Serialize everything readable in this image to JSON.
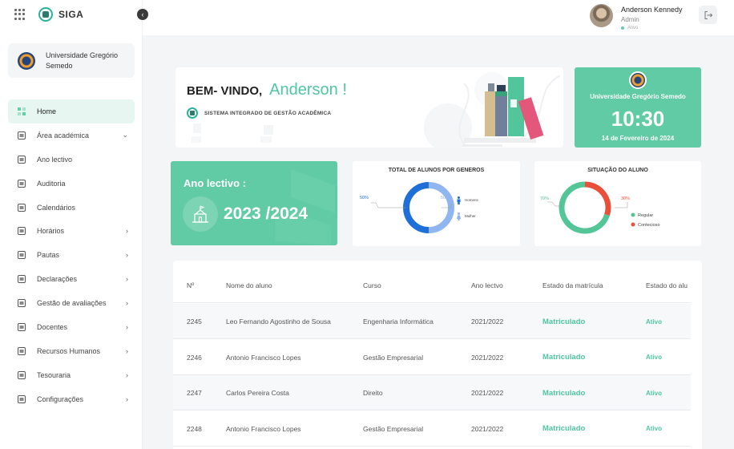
{
  "app": {
    "name": "SIGA"
  },
  "sidebar": {
    "university": "Universidade Gregório Semedo",
    "items": [
      {
        "label": "Home",
        "active": true,
        "chevron": ""
      },
      {
        "label": "Área académica",
        "chevron": "⌄"
      },
      {
        "label": "Ano lectivo",
        "chevron": ""
      },
      {
        "label": "Auditoria",
        "chevron": ""
      },
      {
        "label": "Calendários",
        "chevron": ""
      },
      {
        "label": "Horários",
        "chevron": "›"
      },
      {
        "label": "Pautas",
        "chevron": "›"
      },
      {
        "label": "Declarações",
        "chevron": "›"
      },
      {
        "label": "Gestão de avaliações",
        "chevron": "›"
      },
      {
        "label": "Docentes",
        "chevron": "›"
      },
      {
        "label": "Recursos Humanos",
        "chevron": "›"
      },
      {
        "label": "Tesouraria",
        "chevron": "›"
      },
      {
        "label": "Configurações",
        "chevron": "›"
      }
    ]
  },
  "header": {
    "user_name": "Anderson Kennedy",
    "user_role": "Admin",
    "user_status": "Ativo"
  },
  "welcome": {
    "greeting": "BEM- VINDO,",
    "name": "Anderson !",
    "subtitle": "SISTEMA INTEGRADO DE GESTÃO ACADÊMICA"
  },
  "clock": {
    "university": "Universidade Gregório Semedo",
    "time": "10:30",
    "date": "14 de Fevereiro de 2024"
  },
  "year_card": {
    "label": "Ano lectivo :",
    "value": "2023 /2024"
  },
  "colors": {
    "accent": "#60cba5",
    "accent_text": "#4fc7a0",
    "male": "#1f6fd8",
    "female": "#8fb6f0",
    "regular": "#54c596",
    "contencioso": "#e8503a"
  },
  "chart_data": [
    {
      "type": "pie",
      "title": "TOTAL DE ALUNOS POR GENEROS",
      "labels": [
        "Homens",
        "Mulher"
      ],
      "values": [
        50,
        50
      ],
      "value_labels": [
        "50%",
        "50%"
      ],
      "legend_position": "right"
    },
    {
      "type": "pie",
      "title": "SITUAÇÃO DO ALUNO",
      "labels": [
        "Regular",
        "Contecioso"
      ],
      "values": [
        70,
        30
      ],
      "value_labels": [
        "70%",
        "30%"
      ],
      "legend_position": "right"
    }
  ],
  "table": {
    "columns": [
      "Nº",
      "Nome do aluno",
      "Curso",
      "Ano lectvo",
      "Estado da matrícula",
      "Estado do alu"
    ],
    "rows": [
      [
        "2245",
        "Leo Fernando Agostinho de Sousa",
        "Engenharia Informática",
        "2021/2022",
        "Matriculado",
        "Ativo"
      ],
      [
        "2246",
        "Antonio Francisco Lopes",
        "Gestão Empresarial",
        "2021/2022",
        "Matriculado",
        "Ativo"
      ],
      [
        "2247",
        "Carlos Pereira Costa",
        "Direito",
        "2021/2022",
        "Matriculado",
        "Ativo"
      ],
      [
        "2248",
        "Antonio Francisco Lopes",
        "Gestão Empresarial",
        "2021/2022",
        "Matriculado",
        "Ativo"
      ]
    ]
  }
}
